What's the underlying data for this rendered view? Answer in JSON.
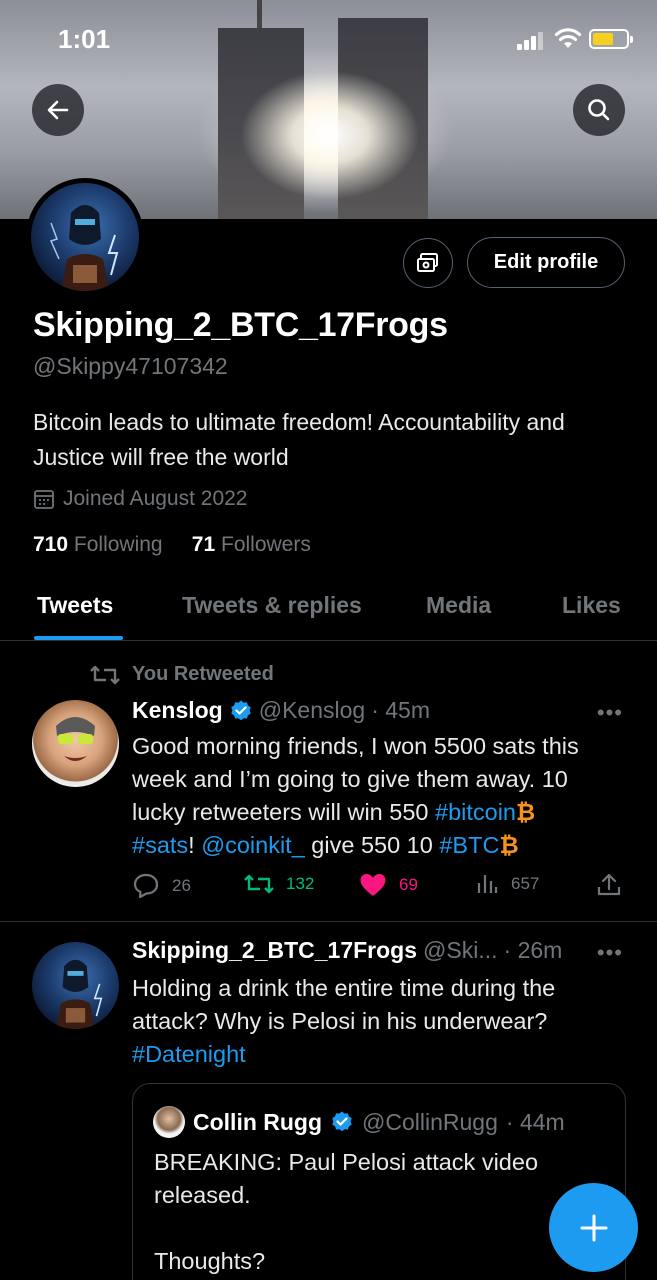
{
  "status_bar": {
    "time": "1:01"
  },
  "profile": {
    "display_name": "Skipping_2_BTC_17Frogs",
    "handle": "@Skippy47107342",
    "bio": "Bitcoin leads to ultimate freedom! Accountability and Justice will free the world",
    "joined": "Joined August 2022",
    "following_count": "710",
    "following_label": "Following",
    "followers_count": "71",
    "followers_label": "Followers",
    "edit_button": "Edit profile"
  },
  "tabs": [
    "Tweets",
    "Tweets & replies",
    "Media",
    "Likes"
  ],
  "tweets": [
    {
      "retweet_label": "You Retweeted",
      "name": "Kenslog",
      "handle": "@Kenslog",
      "time": "· 45m",
      "body_line1": "Good morning friends, I won 5500 sats this",
      "body_line2": "week and I’m going to give them away. 10",
      "body_line3a": "lucky retweeters will win 550 ",
      "hashtag_bitcoin": "#bitcoin",
      "hashtag_sats": "#sats",
      "body_line4b": "! ",
      "mention": "@coinkit_",
      "body_line4c": " give 550 10 ",
      "hashtag_btc": "#BTC",
      "btc_symbol": "₿",
      "replies": "26",
      "retweets": "132",
      "likes": "69",
      "views": "657"
    },
    {
      "name": "Skipping_2_BTC_17Frogs",
      "handle": "@Ski...",
      "time": "· 26m",
      "body": "Holding a drink the entire time during the attack?  Why is Pelosi in his underwear?",
      "hashtag": "#Datenight",
      "quote": {
        "name": "Collin Rugg",
        "handle": "@CollinRugg",
        "time": "· 44m",
        "line1": "BREAKING: Paul Pelosi attack video released.",
        "line2": "Thoughts?"
      }
    }
  ],
  "colors": {
    "accent": "#1d9bf0",
    "like": "#f91880",
    "retweet": "#00ba7c",
    "btc": "#f7931a"
  }
}
